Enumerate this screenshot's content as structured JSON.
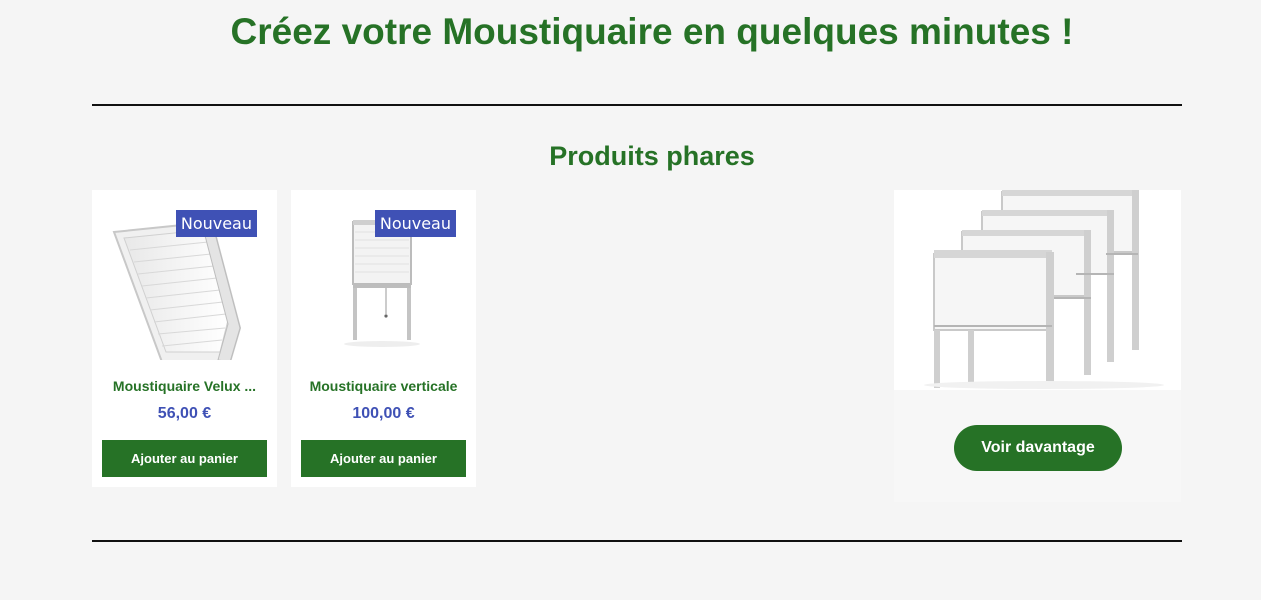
{
  "page": {
    "title": "Créez votre Moustiquaire en quelques minutes !"
  },
  "featured": {
    "title": "Produits phares",
    "products": [
      {
        "badge": "Nouveau",
        "name": "Moustiquaire Velux ...",
        "price": "56,00 €",
        "button_label": "Ajouter au panier",
        "image_icon": "roof-window-screen-icon"
      },
      {
        "badge": "Nouveau",
        "name": "Moustiquaire verticale",
        "price": "100,00 €",
        "button_label": "Ajouter au panier",
        "image_icon": "vertical-screen-icon"
      }
    ],
    "promo": {
      "button_label": "Voir davantage",
      "image_icon": "screens-group-icon"
    }
  },
  "colors": {
    "brand_green": "#267226",
    "badge_blue": "#3f51b5",
    "background": "#f5f5f5"
  }
}
